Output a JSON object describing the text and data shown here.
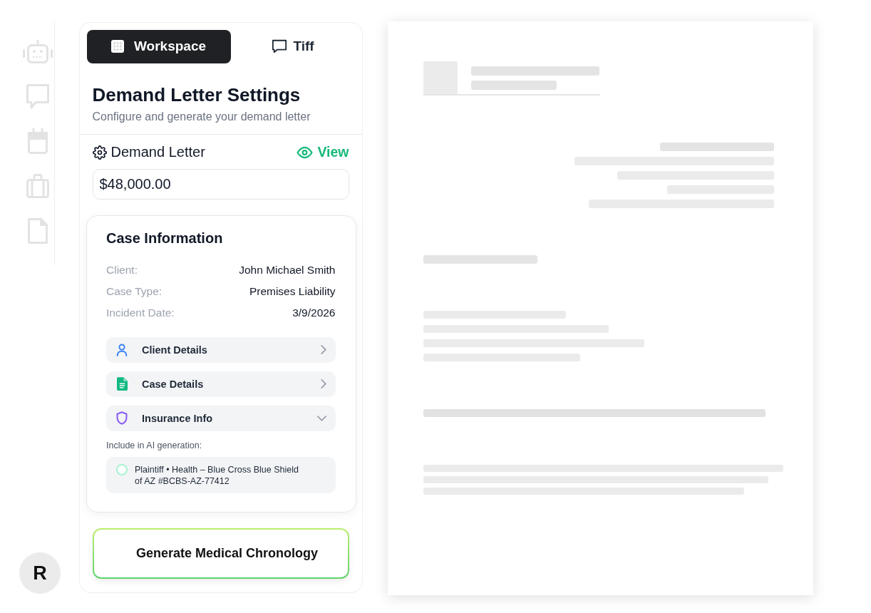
{
  "sidebar": {
    "avatar": "R"
  },
  "tabs": [
    {
      "label": "Workspace",
      "selected": true
    },
    {
      "label": "Tiff",
      "selected": false
    }
  ],
  "settings": {
    "title": "Demand Letter Settings",
    "subtitle": "Configure and generate your demand letter"
  },
  "demand_letter": {
    "label": "Demand Letter",
    "view_link": "View",
    "amount": "$48,000.00"
  },
  "case_information": {
    "title": "Case Information",
    "fields": [
      {
        "label": "Client:",
        "value": "John Michael Smith"
      },
      {
        "label": "Case Type:",
        "value": "Premises Liability"
      },
      {
        "label": "Incident Date:",
        "value": "3/9/2026"
      }
    ],
    "sections": [
      {
        "label": "Client Details",
        "expanded": false,
        "color": "#3b82f6"
      },
      {
        "label": "Case Details",
        "expanded": false,
        "color": "#10b981"
      },
      {
        "label": "Insurance Info",
        "expanded": true,
        "color": "#8b5cf6",
        "include_label": "Include in AI generation:",
        "policies": [
          {
            "label": "Plaintiff • Health – Blue Cross Blue Shield of AZ #BCBS-AZ-77412",
            "checked": false
          }
        ]
      }
    ]
  },
  "generate_button": "Generate Medical Chronology"
}
